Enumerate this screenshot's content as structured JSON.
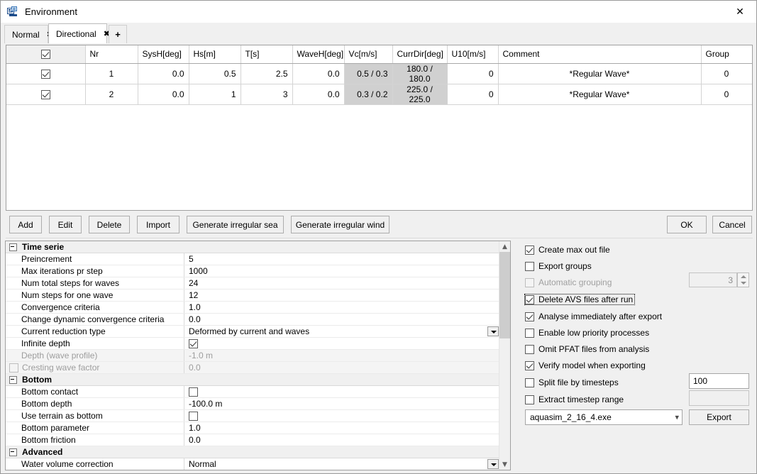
{
  "window": {
    "title": "Environment",
    "icon": "app-icon",
    "close_label": "✕"
  },
  "tabs": {
    "items": [
      {
        "label": "Normal",
        "close": "✖",
        "active": false
      },
      {
        "label": "Directional",
        "close": "✖",
        "active": true
      }
    ],
    "add_label": "+"
  },
  "table": {
    "headers": [
      "",
      "Nr",
      "SysH[deg]",
      "Hs[m]",
      "T[s]",
      "WaveH[deg]",
      "Vc[m/s]",
      "CurrDir[deg]",
      "U10[m/s]",
      "Comment",
      "Group"
    ],
    "header_checkbox_checked": true,
    "rows": [
      {
        "checked": true,
        "nr": "1",
        "sysh": "0.0",
        "hs": "0.5",
        "t": "2.5",
        "waveh": "0.0",
        "vc": "0.5 / 0.3",
        "currdir": "180.0 / 180.0",
        "u10": "0",
        "comment": "*Regular Wave*",
        "group": "0"
      },
      {
        "checked": true,
        "nr": "2",
        "sysh": "0.0",
        "hs": "1",
        "t": "3",
        "waveh": "0.0",
        "vc": "0.3 / 0.2",
        "currdir": "225.0 / 225.0",
        "u10": "0",
        "comment": "*Regular Wave*",
        "group": "0"
      }
    ]
  },
  "toolbar": {
    "add": "Add",
    "edit": "Edit",
    "delete": "Delete",
    "import": "Import",
    "gen_sea": "Generate irregular sea",
    "gen_wind": "Generate irregular wind",
    "ok": "OK",
    "cancel": "Cancel"
  },
  "properties": {
    "cat_timeserie": "Time serie",
    "cat_bottom": "Bottom",
    "cat_advanced": "Advanced",
    "rows": [
      {
        "name": "Preincrement",
        "value": "5"
      },
      {
        "name": "Max iterations pr step",
        "value": "1000"
      },
      {
        "name": "Num total steps for waves",
        "value": "24"
      },
      {
        "name": "Num steps for one wave",
        "value": "12"
      },
      {
        "name": "Convergence criteria",
        "value": "1.0"
      },
      {
        "name": "Change dynamic convergence criteria",
        "value": "0.0"
      },
      {
        "name": "Current reduction type",
        "value": "Deformed by current and waves"
      },
      {
        "name": "Infinite depth",
        "value": ""
      },
      {
        "name": "Depth (wave profile)",
        "value": "-1.0 m"
      },
      {
        "name": "Cresting wave factor",
        "value": "0.0"
      },
      {
        "name": "Bottom contact",
        "value": ""
      },
      {
        "name": "Bottom depth",
        "value": "-100.0 m"
      },
      {
        "name": "Use terrain as bottom",
        "value": ""
      },
      {
        "name": "Bottom parameter",
        "value": "1.0"
      },
      {
        "name": "Bottom friction",
        "value": "0.0"
      },
      {
        "name": "Water volume correction",
        "value": "Normal"
      }
    ]
  },
  "options": {
    "create_max_out_file": "Create max out file",
    "export_groups": "Export groups",
    "automatic_grouping": "Automatic grouping",
    "automatic_grouping_value": "3",
    "delete_avs": "Delete AVS files after run",
    "analyse_immediately": "Analyse immediately after export",
    "enable_low_priority": "Enable low priority processes",
    "omit_pfat": "Omit PFAT files from analysis",
    "verify_model": "Verify model when exporting",
    "split_file": "Split file by timesteps",
    "split_file_value": "100",
    "extract_range": "Extract timestep range",
    "extract_range_value": "",
    "executable": "aquasim_2_16_4.exe",
    "export_button": "Export"
  },
  "colors": {
    "selected_cell": "#d0d0d0",
    "window_bg": "#f0f0f0",
    "title_text": "#000000"
  }
}
